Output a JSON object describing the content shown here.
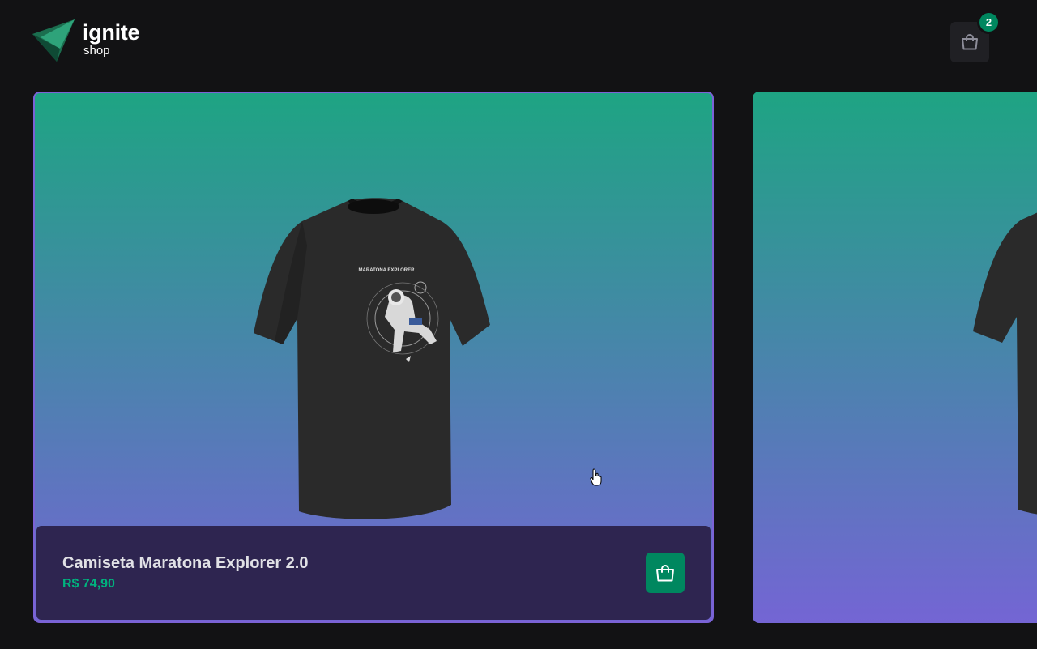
{
  "brand": {
    "name": "ignite",
    "tagline": "shop",
    "logo_icon": "triangle-logo-icon"
  },
  "header": {
    "cart_icon": "shopping-bag-icon",
    "cart_count": "2"
  },
  "products": [
    {
      "name": "Camiseta Maratona Explorer 2.0",
      "price": "R$ 74,90",
      "image_icon": "tshirt-image",
      "print_text": "MARATONA EXPLORER",
      "add_icon": "shopping-bag-icon"
    }
  ],
  "colors": {
    "background": "#121214",
    "brand_green": "#00875f",
    "price_green": "#00b37e",
    "gradient_top": "#1ea483",
    "gradient_bottom": "#7465d4",
    "footer_bg": "#2e2550"
  }
}
